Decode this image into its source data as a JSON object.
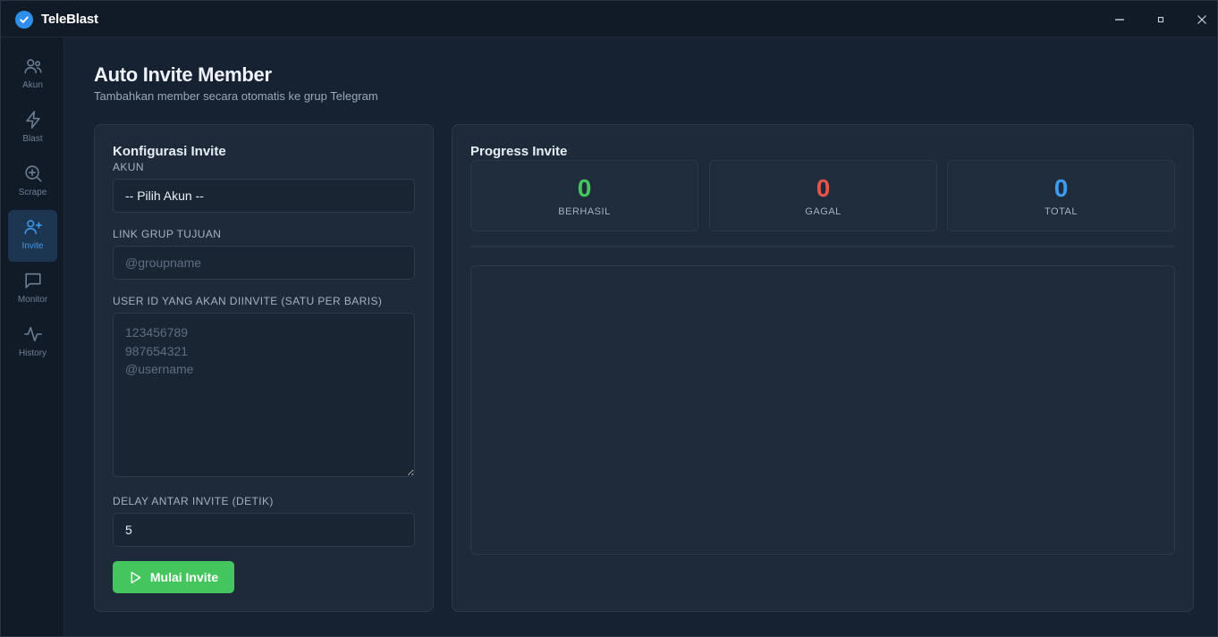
{
  "app": {
    "title": "TeleBlast",
    "accent": "#3d9bf0"
  },
  "window_controls": [
    "minimize-icon",
    "maximize-icon",
    "close-icon"
  ],
  "sidebar": {
    "items": [
      {
        "label": "Akun",
        "icon": "users-icon",
        "active": false
      },
      {
        "label": "Blast",
        "icon": "lightning-icon",
        "active": false
      },
      {
        "label": "Scrape",
        "icon": "search-plus-icon",
        "active": false
      },
      {
        "label": "Invite",
        "icon": "user-plus-icon",
        "active": true
      },
      {
        "label": "Monitor",
        "icon": "message-square-icon",
        "active": false
      },
      {
        "label": "History",
        "icon": "activity-icon",
        "active": false
      }
    ]
  },
  "page": {
    "title": "Auto Invite Member",
    "subtitle": "Tambahkan member secara otomatis ke grup Telegram"
  },
  "config": {
    "title": "Konfigurasi Invite",
    "account_label": "AKUN",
    "account_value": "-- Pilih Akun --",
    "group_label": "LINK GRUP TUJUAN",
    "group_placeholder": "@groupname",
    "users_label": "USER ID YANG AKAN DIINVITE (SATU PER BARIS)",
    "users_placeholder": "123456789\n987654321\n@username",
    "delay_label": "DELAY ANTAR INVITE (DETIK)",
    "delay_value": "5",
    "start_label": "Mulai Invite"
  },
  "progress": {
    "title": "Progress Invite",
    "fraction": 0,
    "stats": [
      {
        "value": "0",
        "label": "BERHASIL",
        "color": "#45c55d"
      },
      {
        "value": "0",
        "label": "GAGAL",
        "color": "#e5534b"
      },
      {
        "value": "0",
        "label": "TOTAL",
        "color": "#3d9bf0"
      }
    ]
  }
}
